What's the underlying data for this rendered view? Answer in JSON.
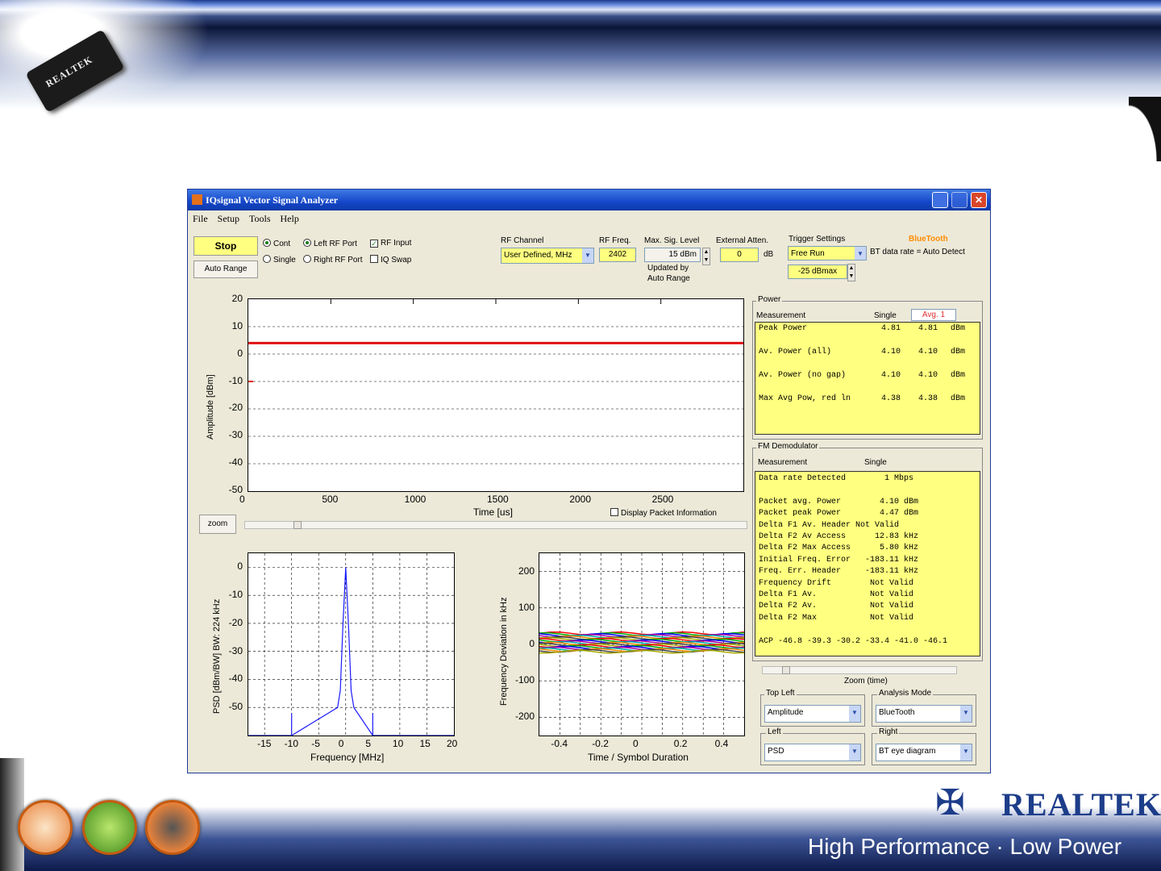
{
  "slide": {
    "brand_name": "REALTEK",
    "tagline": "High Performance · Low Power",
    "chip_label": "REALTEK"
  },
  "window": {
    "title": "IQsignal Vector Signal Analyzer",
    "menu": [
      "File",
      "Setup",
      "Tools",
      "Help"
    ]
  },
  "controls": {
    "stop_label": "Stop",
    "auto_range_label": "Auto Range",
    "radio_cont": "Cont",
    "radio_single": "Single",
    "radio_left_port": "Left RF Port",
    "radio_right_port": "Right RF Port",
    "check_rf_input": "RF Input",
    "check_iq_swap": "IQ Swap",
    "rf_channel_label": "RF Channel",
    "rf_channel_value": "User Defined, MHz",
    "rf_freq_label": "RF Freq.",
    "rf_freq_value": "2402",
    "max_sig_label": "Max. Sig. Level",
    "max_sig_value": "15  dBm",
    "updated_by": "Updated by",
    "auto_range_note": "Auto Range",
    "ext_atten_label": "External Atten.",
    "ext_atten_value": "0",
    "ext_atten_unit": "dB",
    "trigger_label": "Trigger Settings",
    "trigger_value": "Free Run",
    "trigger_level": "-25  dBmax",
    "bt_label": "BlueTooth",
    "bt_rate": "BT data rate = Auto Detect"
  },
  "top_plot": {
    "ylabel": "Amplitude [dBm]",
    "xlabel": "Time [us]",
    "yticks": [
      "20",
      "10",
      "0",
      "-10",
      "-20",
      "-30",
      "-40",
      "-50"
    ],
    "xticks": [
      "0",
      "500",
      "1000",
      "1500",
      "2000",
      "2500"
    ],
    "display_packet": "Display Packet Information",
    "zoom_label": "zoom"
  },
  "psd_plot": {
    "ylabel": "PSD  [dBm/BW]  BW: 224 kHz",
    "xlabel": "Frequency [MHz]",
    "yticks": [
      "0",
      "-10",
      "-20",
      "-30",
      "-40",
      "-50"
    ],
    "xticks": [
      "-15",
      "-10",
      "-5",
      "0",
      "5",
      "10",
      "15",
      "20"
    ]
  },
  "eye_plot": {
    "ylabel": "Frequency Deviation in kHz",
    "xlabel": "Time / Symbol Duration",
    "yticks": [
      "200",
      "100",
      "0",
      "-100",
      "-200"
    ],
    "xticks": [
      "-0.4",
      "-0.2",
      "0",
      "0.2",
      "0.4"
    ]
  },
  "power": {
    "title": "Power",
    "col_measurement": "Measurement",
    "col_single": "Single",
    "avg_label": "Avg.  1",
    "rows": [
      {
        "name": "Peak Power",
        "single": "4.81",
        "avg": "4.81",
        "unit": "dBm"
      },
      {
        "name": "Av. Power (all)",
        "single": "4.10",
        "avg": "4.10",
        "unit": "dBm"
      },
      {
        "name": "Av. Power (no gap)",
        "single": "4.10",
        "avg": "4.10",
        "unit": "dBm"
      },
      {
        "name": "Max Avg Pow, red ln",
        "single": "4.38",
        "avg": "4.38",
        "unit": "dBm"
      }
    ]
  },
  "fm": {
    "title": "FM Demodulator",
    "col_measurement": "Measurement",
    "col_single": "Single",
    "lines": [
      "Data rate Detected        1 Mbps",
      "",
      "Packet avg. Power        4.10 dBm",
      "Packet peak Power        4.47 dBm",
      "Delta F1 Av. Header Not Valid",
      "Delta F2 Av Access      12.83 kHz",
      "Delta F2 Max Access      5.80 kHz",
      "Initial Freq. Error   -183.11 kHz",
      "Freq. Err. Header     -183.11 kHz",
      "Frequency Drift        Not Valid",
      "Delta F1 Av.           Not Valid",
      "Delta F2 Av.           Not Valid",
      "Delta F2 Max           Not Valid",
      "",
      "ACP -46.8 -39.3 -30.2 -33.4 -41.0 -46.1"
    ]
  },
  "bottom_right": {
    "zoom_time": "Zoom (time)",
    "top_left_label": "Top Left",
    "top_left_value": "Amplitude",
    "analysis_label": "Analysis Mode",
    "analysis_value": "BlueTooth",
    "left_label": "Left",
    "left_value": "PSD",
    "right_label": "Right",
    "right_value": "BT eye diagram"
  },
  "chart_data": [
    {
      "type": "line",
      "ylabel": "Amplitude [dBm]",
      "xlabel": "Time [us]",
      "xlim": [
        0,
        3000
      ],
      "ylim": [
        -50,
        20
      ],
      "series": [
        {
          "x": [
            0,
            3000
          ],
          "values": [
            4,
            4
          ]
        }
      ]
    },
    {
      "type": "line",
      "ylabel": "PSD  [dBm/BW]  BW: 224 kHz",
      "xlabel": "Frequency [MHz]",
      "xlim": [
        -18,
        20
      ],
      "ylim": [
        -60,
        5
      ],
      "series": [
        {
          "x": [
            -18,
            -10,
            -10,
            -10,
            -1.5,
            -1,
            -0.5,
            0,
            0.5,
            1,
            1.5,
            5,
            5,
            5,
            20
          ],
          "values": [
            -60,
            -60,
            -52,
            -60,
            -50,
            -44,
            -20,
            0,
            -20,
            -44,
            -50,
            -60,
            -52,
            -60,
            -60
          ]
        }
      ]
    },
    {
      "type": "line",
      "ylabel": "Frequency Deviation in kHz",
      "xlabel": "Time / Symbol Duration",
      "xlim": [
        -0.5,
        0.5
      ],
      "ylim": [
        -250,
        250
      ],
      "series": [
        {
          "x": [
            -0.5,
            0.5
          ],
          "values": [
            30,
            30
          ]
        },
        {
          "x": [
            -0.5,
            0.5
          ],
          "values": [
            -20,
            -20
          ]
        }
      ]
    }
  ]
}
